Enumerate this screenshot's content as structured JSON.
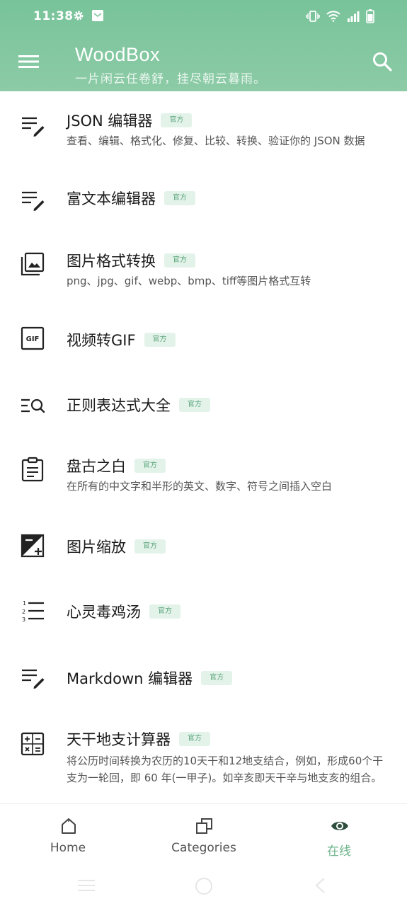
{
  "status_bar": {
    "time": "11:38"
  },
  "app_bar": {
    "title": "WoodBox",
    "subtitle": "一片闲云任卷舒，挂尽朝云暮雨。"
  },
  "tools": [
    {
      "title": "JSON 编辑器",
      "badge": "官方",
      "desc": "查看、编辑、格式化、修复、比较、转换、验证你的 JSON 数据",
      "icon": "edit-lines-icon"
    },
    {
      "title": "富文本编辑器",
      "badge": "官方",
      "desc": "",
      "icon": "edit-lines-icon"
    },
    {
      "title": "图片格式转换",
      "badge": "官方",
      "desc": "png、jpg、gif、webp、bmp、tiff等图片格式互转",
      "icon": "image-library-icon"
    },
    {
      "title": "视频转GIF",
      "badge": "官方",
      "desc": "",
      "icon": "gif-icon"
    },
    {
      "title": "正则表达式大全",
      "badge": "官方",
      "desc": "",
      "icon": "text-search-icon"
    },
    {
      "title": "盘古之白",
      "badge": "官方",
      "desc": "在所有的中文字和半形的英文、数字、符号之间插入空白",
      "icon": "clipboard-text-icon"
    },
    {
      "title": "图片缩放",
      "badge": "官方",
      "desc": "",
      "icon": "exposure-icon"
    },
    {
      "title": "心灵毒鸡汤",
      "badge": "官方",
      "desc": "",
      "icon": "numbered-list-icon"
    },
    {
      "title": "Markdown 编辑器",
      "badge": "官方",
      "desc": "",
      "icon": "edit-lines-icon"
    },
    {
      "title": "天干地支计算器",
      "badge": "官方",
      "desc": "将公历时间转换为农历的10天干和12地支结合，例如，形成60个干支为一轮回，即 60 年(一甲子)。如辛亥即天干辛与地支亥的组合。",
      "icon": "calculator-icon"
    }
  ],
  "bottom_nav": [
    {
      "label": "Home",
      "icon": "home-icon"
    },
    {
      "label": "Categories",
      "icon": "categories-icon"
    },
    {
      "label": "在线",
      "icon": "eye-icon"
    }
  ],
  "colors": {
    "header": "#7cc59d",
    "accent": "#6cb48a",
    "badge_bg": "#e4f3ea"
  }
}
